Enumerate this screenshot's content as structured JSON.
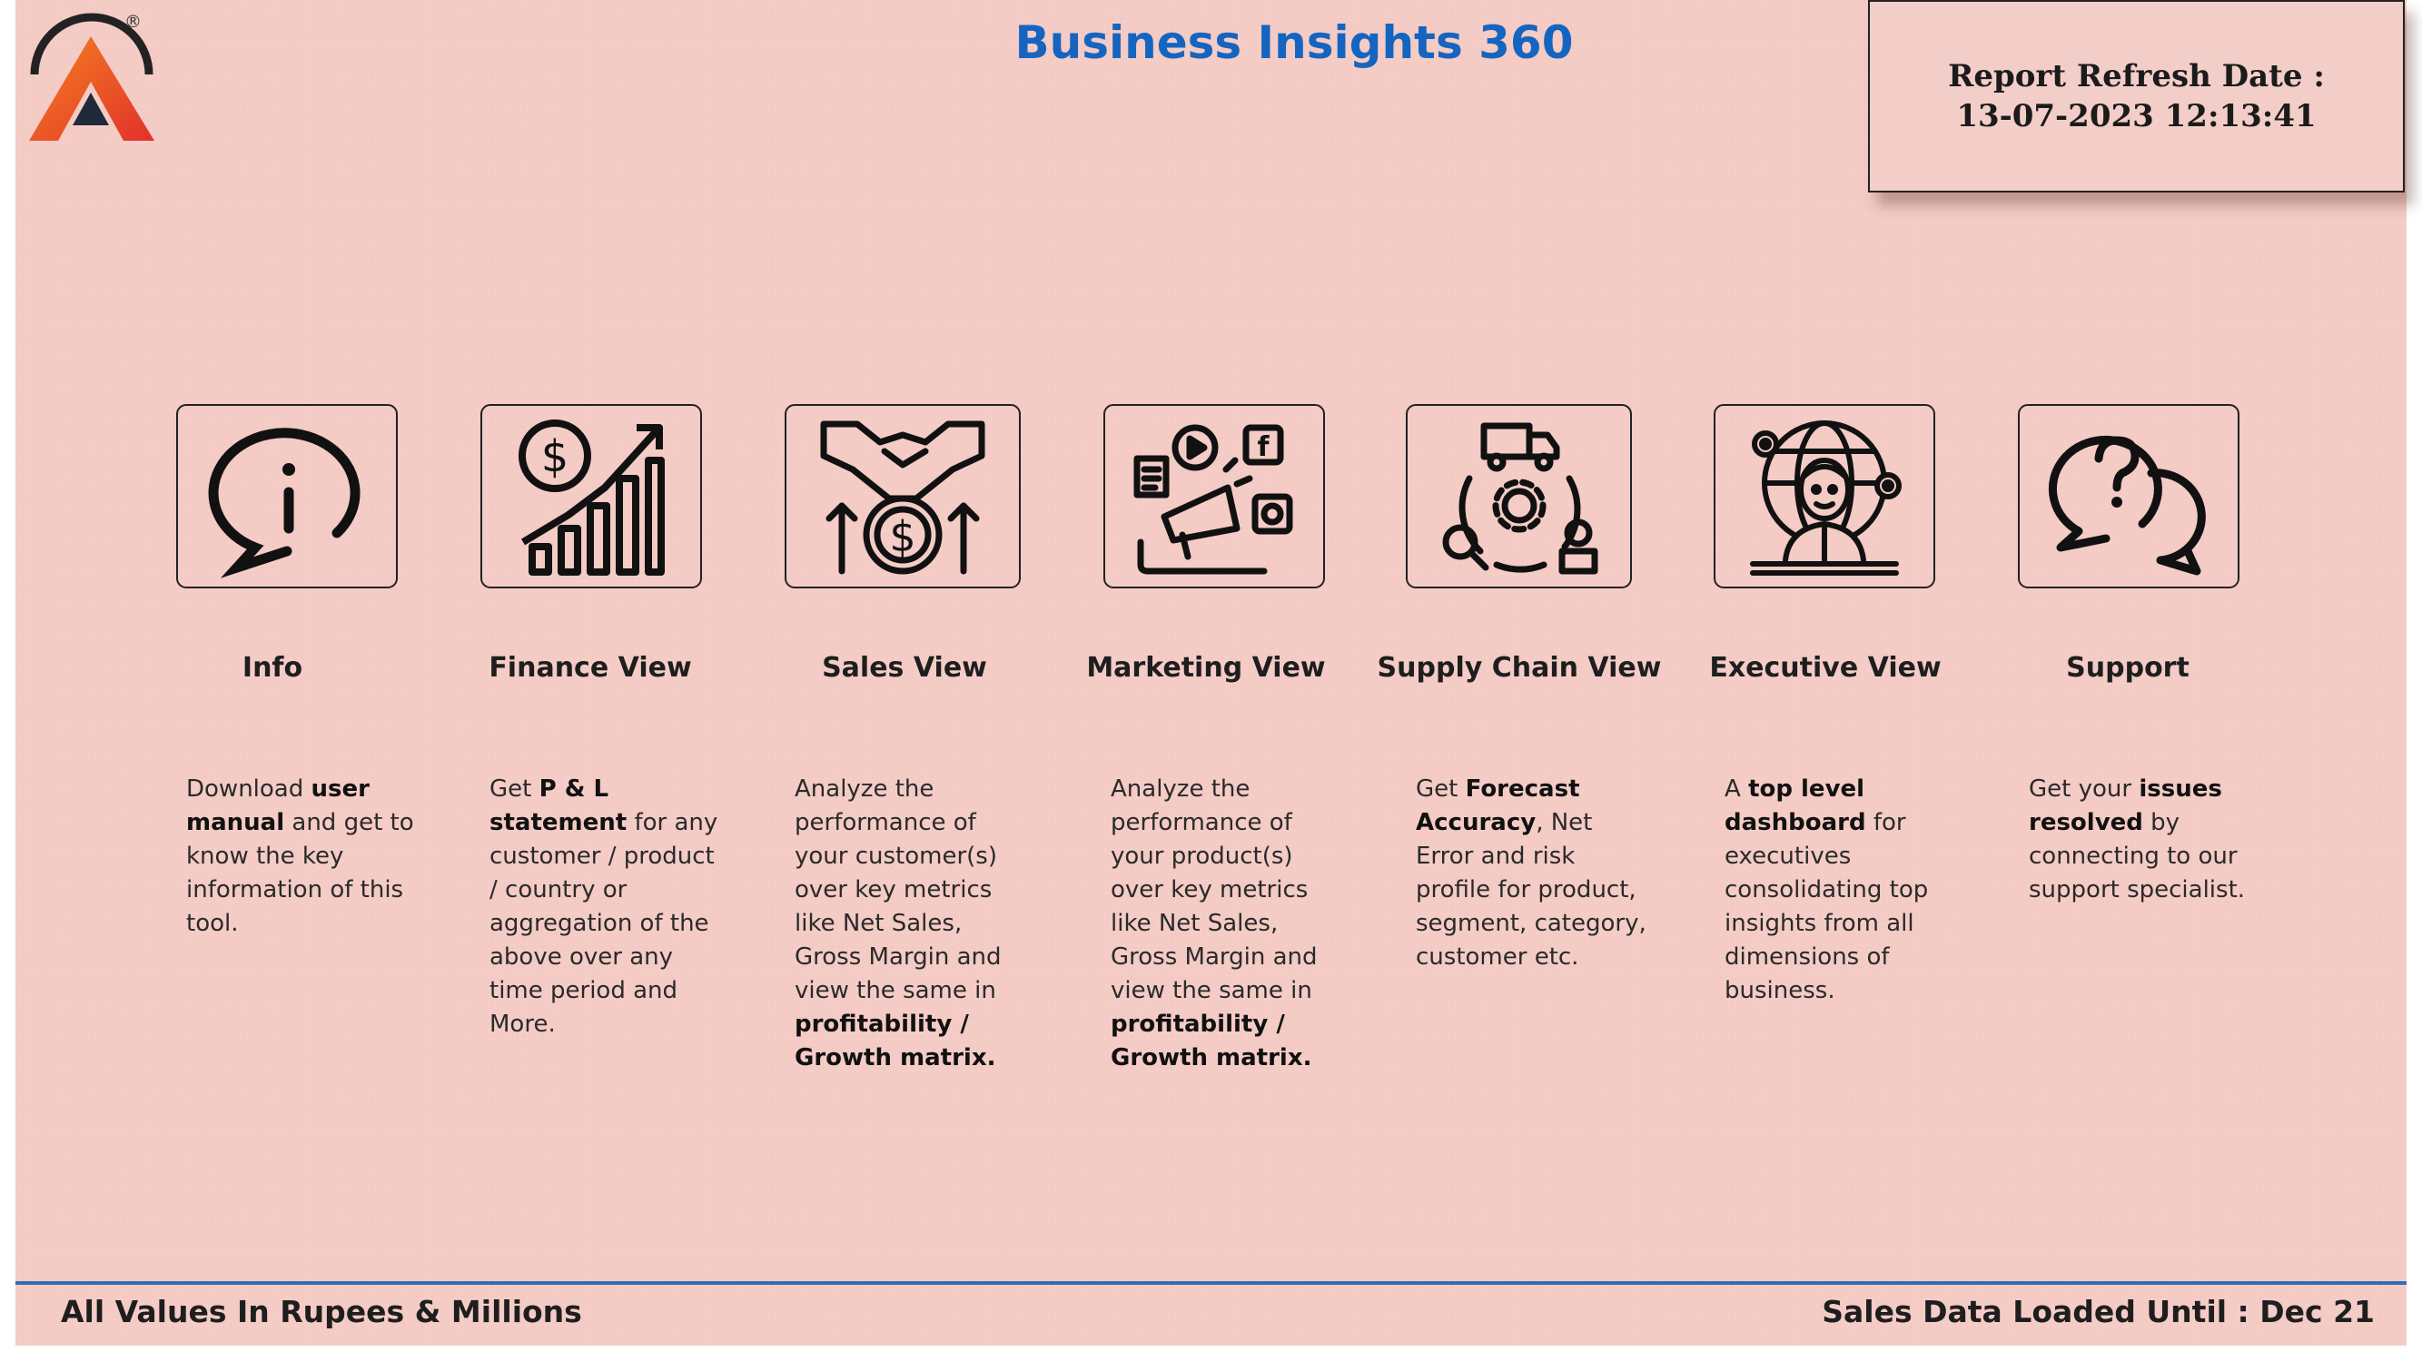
{
  "header": {
    "title": "Business Insights 360",
    "registered_mark": "®",
    "refresh_label": "Report Refresh Date :",
    "refresh_value": "13-07-2023 12:13:41"
  },
  "nav": [
    {
      "id": "info",
      "icon": "info-chat-icon",
      "title": "Info",
      "desc": [
        "Download ",
        "<b>user manual</b>",
        " and get to know the key information of this tool."
      ]
    },
    {
      "id": "finance",
      "icon": "finance-growth-icon",
      "title": "Finance View",
      "desc": [
        "Get  ",
        "<b>P & L statement</b>",
        " for any customer / product / country or aggregation of the above over any time period and More."
      ]
    },
    {
      "id": "sales",
      "icon": "handshake-money-icon",
      "title": "Sales View",
      "desc": [
        "Analyze the performance of your customer(s) over key metrics like Net Sales, Gross Margin and view the same in ",
        "<b>profitability / Growth matrix.</b>"
      ]
    },
    {
      "id": "marketing",
      "icon": "megaphone-social-icon",
      "title": "Marketing View",
      "desc": [
        "Analyze the performance of your product(s) over key metrics like Net Sales, Gross Margin and view the same in ",
        "<b>profitability / Growth matrix.</b>"
      ]
    },
    {
      "id": "supply",
      "icon": "supply-chain-cycle-icon",
      "title": "Supply Chain View",
      "desc": [
        "Get ",
        "<b>Forecast Accuracy</b>",
        ", Net Error and risk profile for product, segment, category, customer etc."
      ]
    },
    {
      "id": "executive",
      "icon": "executive-globe-icon",
      "title": "Executive View",
      "desc": [
        "A ",
        "<b>top level dashboard</b>",
        " for executives consolidating top insights from all dimensions of business."
      ]
    },
    {
      "id": "support",
      "icon": "support-question-icon",
      "title": "Support",
      "desc": [
        "Get your ",
        "<b>issues resolved</b>",
        " by connecting to our support specialist."
      ]
    }
  ],
  "footer": {
    "left": "All Values In Rupees & Millions",
    "right": "Sales Data Loaded Until : Dec 21"
  },
  "colors": {
    "background": "#f4cbc5",
    "title": "#1565c0",
    "rule": "#2f6db5",
    "logo_orange": "#f26a21",
    "logo_red": "#e23b2e"
  }
}
